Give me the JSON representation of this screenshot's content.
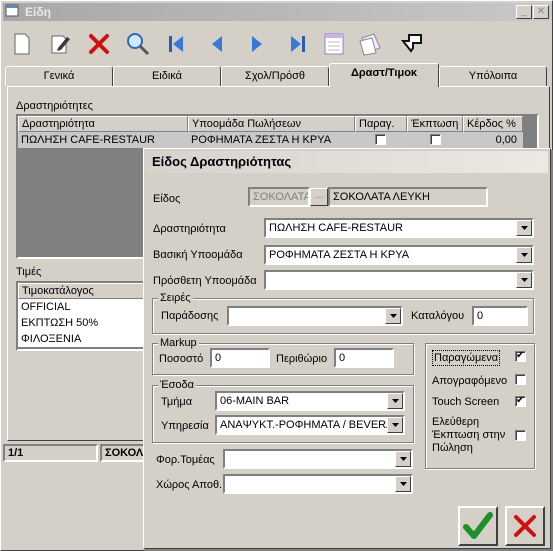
{
  "window": {
    "title": "Είδη"
  },
  "tabs": [
    "Γενικά",
    "Ειδικά",
    "Σχολ/Πρόσθ",
    "Δραστ/Τιμοκ",
    "Υπόλοιπα"
  ],
  "activities": {
    "group_title": "Δραστηριότητες",
    "columns": [
      "Δραστηριότητα",
      "Υποομάδα Πωλήσεων",
      "Παραγ.",
      "Έκπτωση",
      "Κέρδος %"
    ],
    "rows": [
      {
        "activity": "ΠΩΛΗΣΗ CAFE-RESTAUR",
        "subgroup": "ΡΟΦΗΜΑΤΑ ΖΕΣΤΑ Η ΚΡΥΑ",
        "production": false,
        "discount": false,
        "profit": "0,00"
      }
    ]
  },
  "prices": {
    "group_title": "Τιμές",
    "column": "Τιμοκατάλογος",
    "rows": [
      "OFFICIAL",
      "ΕΚΠΤΩΣΗ 50%",
      "ΦΙΛΟΞΕΝΙΑ"
    ]
  },
  "status": {
    "record": "1/1",
    "item": "ΣΟΚΟΛ"
  },
  "dialog": {
    "title": "Είδος Δραστηριότητας",
    "item_label": "Είδος",
    "item_code": "ΣΟΚΟΛΑΤΑ",
    "item_browse": "...",
    "item_name": "ΣΟΚΟΛΑΤΑ ΛΕΥΚΗ",
    "activity_label": "Δραστηριότητα",
    "activity_value": "ΠΩΛΗΣΗ CAFE-RESTAUR",
    "basic_subgroup_label": "Βασική Υποομάδα",
    "basic_subgroup_value": "ΡΟΦΗΜΑΤΑ ΖΕΣΤΑ Η ΚΡΥΑ",
    "extra_subgroup_label": "Πρόσθετη Υποομάδα",
    "extra_subgroup_value": "",
    "series_group": "Σειρές",
    "delivery_label": "Παράδοσης",
    "delivery_value": "",
    "catalog_label": "Καταλόγου",
    "catalog_value": "0",
    "markup_group": "Markup",
    "percent_label": "Ποσοστό",
    "percent_value": "0",
    "margin_label": "Περιθώριο",
    "margin_value": "0",
    "revenue_group": "Έσοδα",
    "dept_label": "Τμήμα",
    "dept_value": "06-MAIN BAR",
    "service_label": "Υπηρεσία",
    "service_value": "ΑΝΑΨΥΚΤ.-ΡΟΦΗΜΑΤΑ / BEVERA",
    "tax_sector_label": "Φορ.Τομέας",
    "tax_sector_value": "",
    "storage_label": "Χώρος Αποθ.",
    "storage_value": "",
    "produced_label": "Παραγώμενα",
    "produced": true,
    "inventoried_label": "Απογραφόμενο",
    "inventoried": false,
    "touch_label": "Touch Screen",
    "touch": true,
    "free_discount_label": "Ελεύθερη Έκπτωση στην Πώληση",
    "free_discount": false
  }
}
